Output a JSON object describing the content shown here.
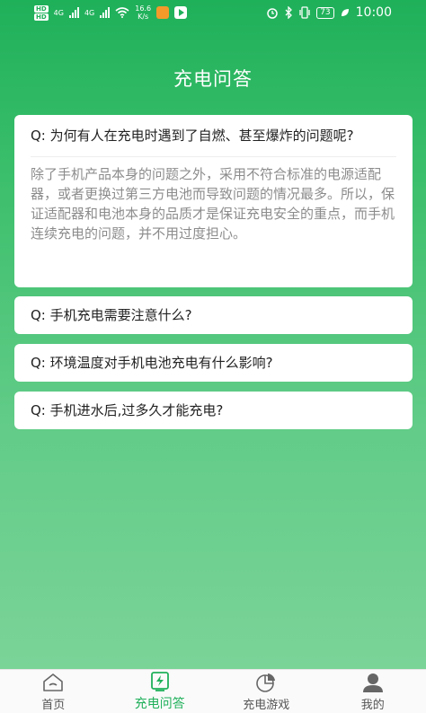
{
  "status_bar": {
    "sim1": "HD",
    "sim2": "HD",
    "net1": "4G",
    "net2": "4G",
    "speed_value": "16.6",
    "speed_unit": "K/s",
    "battery": "73",
    "time": "10:00"
  },
  "header": {
    "title": "充电问答"
  },
  "faq": [
    {
      "question": "Q:  为何有人在充电时遇到了自燃、甚至爆炸的问题呢?",
      "answer": "除了手机产品本身的问题之外，采用不符合标准的电源适配器，或者更换过第三方电池而导致问题的情况最多。所以，保证适配器和电池本身的品质才是保证充电安全的重点，而手机连续充电的问题，并不用过度担心。",
      "expanded": true
    },
    {
      "question": "Q:  手机充电需要注意什么?",
      "expanded": false
    },
    {
      "question": "Q:  环境温度对手机电池充电有什么影响?",
      "expanded": false
    },
    {
      "question": "Q:  手机进水后,过多久才能充电?",
      "expanded": false
    }
  ],
  "bottom_nav": {
    "items": [
      {
        "label": "首页",
        "icon": "home-icon",
        "active": false
      },
      {
        "label": "充电问答",
        "icon": "charging-icon",
        "active": true
      },
      {
        "label": "充电游戏",
        "icon": "pie-chart-icon",
        "active": false
      },
      {
        "label": "我的",
        "icon": "user-icon",
        "active": false
      }
    ]
  },
  "colors": {
    "accent": "#1fb05a",
    "answer_text": "#8c8c8c",
    "inactive_nav": "#555555"
  }
}
